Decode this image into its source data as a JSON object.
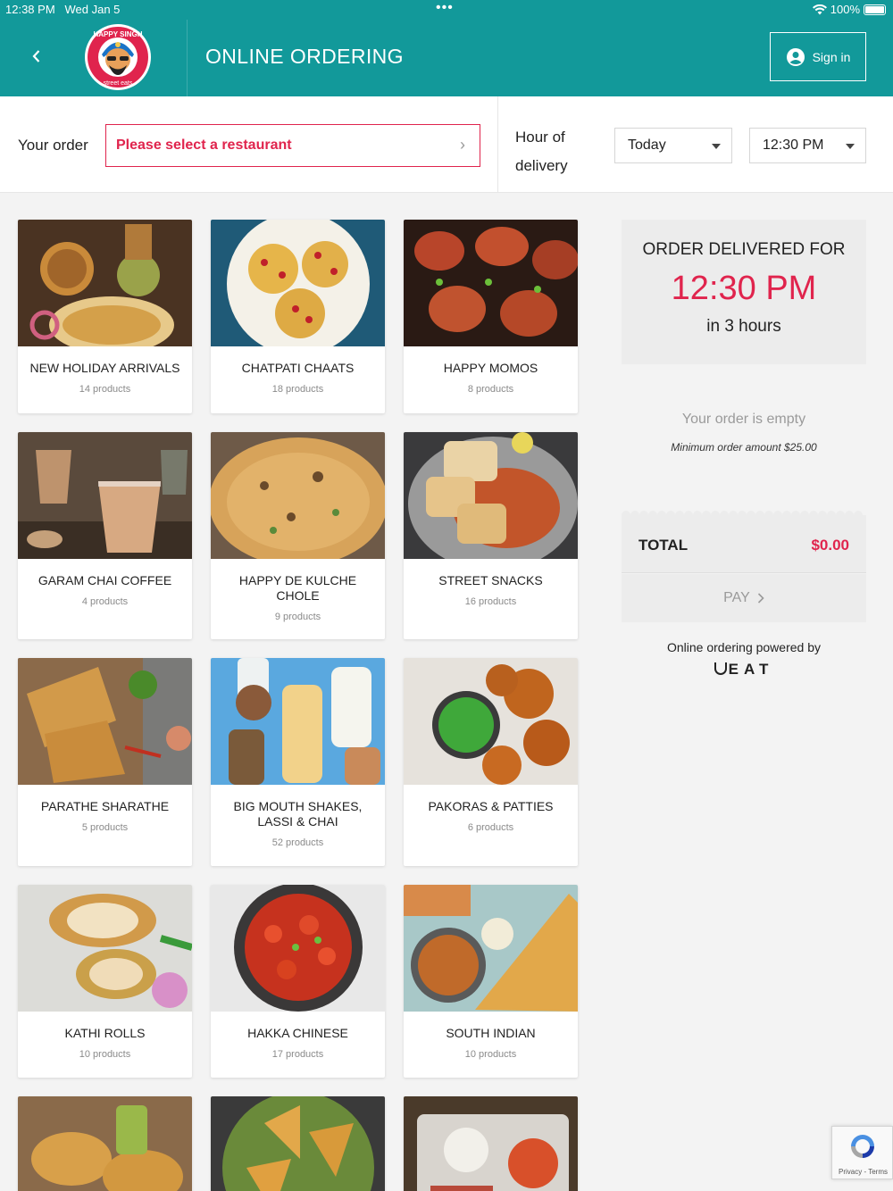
{
  "status_bar": {
    "time": "12:38 PM",
    "date": "Wed Jan 5",
    "battery": "100%"
  },
  "header": {
    "title": "ONLINE ORDERING",
    "sign_in_label": "Sign in",
    "logo_text_top": "HAPPY SINGH",
    "logo_text_bottom": "street eats",
    "brand_color": "#12999a"
  },
  "order_bar": {
    "your_order_label": "Your order",
    "restaurant_placeholder": "Please select a restaurant",
    "hour_label": "Hour of delivery",
    "day_value": "Today",
    "time_value": "12:30 PM",
    "accent_color": "#e0244d"
  },
  "categories": [
    {
      "name": "NEW HOLIDAY ARRIVALS",
      "count": "14 products"
    },
    {
      "name": "CHATPATI CHAATS",
      "count": "18 products"
    },
    {
      "name": "HAPPY MOMOS",
      "count": "8 products"
    },
    {
      "name": "GARAM CHAI COFFEE",
      "count": "4 products"
    },
    {
      "name": "HAPPY DE KULCHE CHOLE",
      "count": "9 products"
    },
    {
      "name": "STREET SNACKS",
      "count": "16 products"
    },
    {
      "name": "PARATHE SHARATHE",
      "count": "5 products"
    },
    {
      "name": "BIG MOUTH SHAKES, LASSI & CHAI",
      "count": "52 products"
    },
    {
      "name": "PAKORAS & PATTIES",
      "count": "6 products"
    },
    {
      "name": "KATHI ROLLS",
      "count": "10 products"
    },
    {
      "name": "HAKKA CHINESE",
      "count": "17 products"
    },
    {
      "name": "SOUTH INDIAN",
      "count": "10 products"
    }
  ],
  "summary": {
    "delivered_for_label": "ORDER DELIVERED FOR",
    "delivery_time": "12:30 PM",
    "delivery_in": "in 3 hours",
    "empty_label": "Your order is empty",
    "minimum_label": "Minimum order amount $25.00",
    "total_label": "TOTAL",
    "total_value": "$0.00",
    "pay_label": "PAY",
    "powered_label": "Online ordering powered by",
    "powered_brand": "EAT"
  },
  "recaptcha": {
    "links": "Privacy - Terms"
  }
}
